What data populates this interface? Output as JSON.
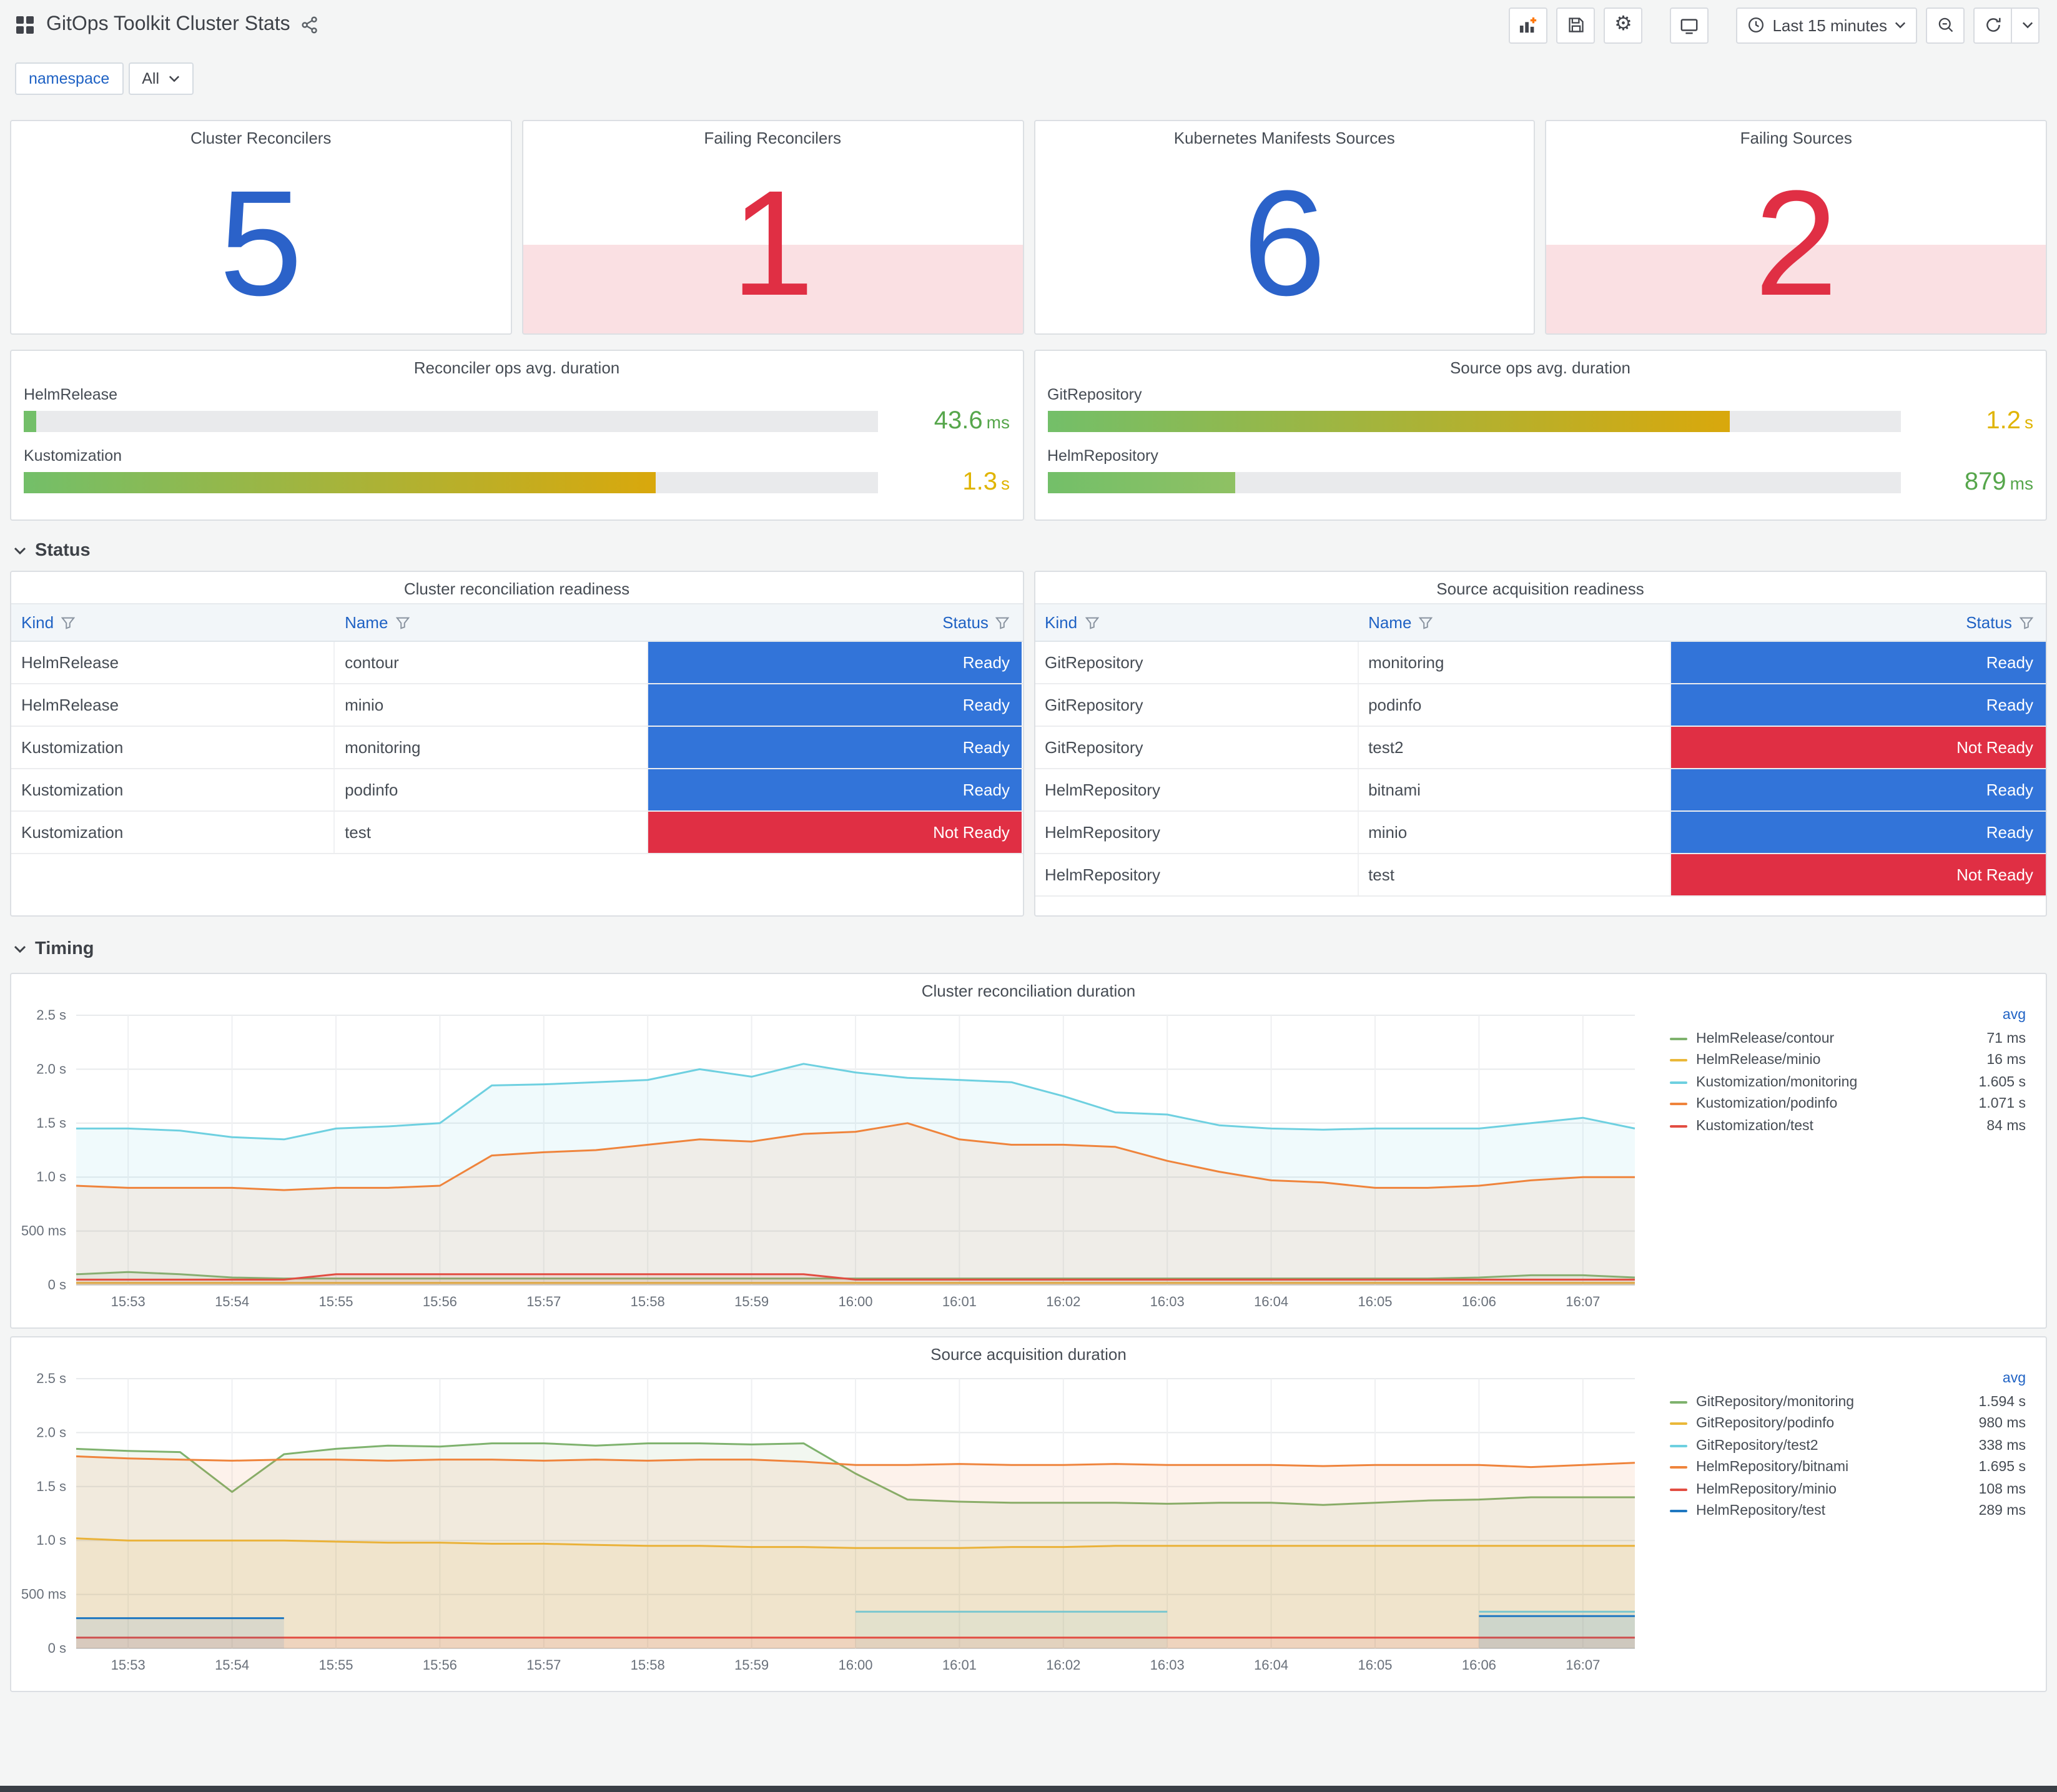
{
  "header": {
    "title": "GitOps Toolkit Cluster Stats",
    "time_range": "Last 15 minutes"
  },
  "variables": {
    "label": "namespace",
    "value": "All"
  },
  "sections": {
    "status": "Status",
    "timing": "Timing"
  },
  "colors": {
    "stat_ok": "#2b62c9",
    "stat_alert": "#e02f44",
    "alert_band": "rgba(224,47,68,0.15)"
  },
  "status_colors": {
    "Ready": "#3274d9",
    "Not Ready": "#e02f44"
  },
  "stats": [
    {
      "title": "Cluster Reconcilers",
      "value": "5",
      "state": "ok"
    },
    {
      "title": "Failing Reconcilers",
      "value": "1",
      "state": "alert"
    },
    {
      "title": "Kubernetes Manifests Sources",
      "value": "6",
      "state": "ok"
    },
    {
      "title": "Failing Sources",
      "value": "2",
      "state": "alert"
    }
  ],
  "gauges": [
    {
      "title": "Reconciler ops avg. duration",
      "rows": [
        {
          "label": "HelmRelease",
          "value": "43.6",
          "unit": "ms",
          "pct": 1.5,
          "value_color": "#56a64b",
          "fill_from": "#73bf69",
          "fill_to": "#73bf69"
        },
        {
          "label": "Kustomization",
          "value": "1.3",
          "unit": "s",
          "pct": 74,
          "value_color": "#e0b400",
          "fill_from": "#73bf69",
          "fill_to": "#d9a80c"
        }
      ]
    },
    {
      "title": "Source ops avg. duration",
      "rows": [
        {
          "label": "GitRepository",
          "value": "1.2",
          "unit": "s",
          "pct": 80,
          "value_color": "#e0b400",
          "fill_from": "#73bf69",
          "fill_to": "#d9a80c"
        },
        {
          "label": "HelmRepository",
          "value": "879",
          "unit": "ms",
          "pct": 22,
          "value_color": "#56a64b",
          "fill_from": "#73bf69",
          "fill_to": "#8fc163"
        }
      ]
    }
  ],
  "tables": [
    {
      "title": "Cluster reconciliation readiness",
      "columns": [
        "Kind",
        "Name",
        "Status"
      ],
      "rows": [
        {
          "kind": "HelmRelease",
          "name": "contour",
          "status": "Ready"
        },
        {
          "kind": "HelmRelease",
          "name": "minio",
          "status": "Ready"
        },
        {
          "kind": "Kustomization",
          "name": "monitoring",
          "status": "Ready"
        },
        {
          "kind": "Kustomization",
          "name": "podinfo",
          "status": "Ready"
        },
        {
          "kind": "Kustomization",
          "name": "test",
          "status": "Not Ready"
        }
      ]
    },
    {
      "title": "Source acquisition readiness",
      "columns": [
        "Kind",
        "Name",
        "Status"
      ],
      "rows": [
        {
          "kind": "GitRepository",
          "name": "monitoring",
          "status": "Ready"
        },
        {
          "kind": "GitRepository",
          "name": "podinfo",
          "status": "Ready"
        },
        {
          "kind": "GitRepository",
          "name": "test2",
          "status": "Not Ready"
        },
        {
          "kind": "HelmRepository",
          "name": "bitnami",
          "status": "Ready"
        },
        {
          "kind": "HelmRepository",
          "name": "minio",
          "status": "Ready"
        },
        {
          "kind": "HelmRepository",
          "name": "test",
          "status": "Not Ready"
        }
      ]
    }
  ],
  "chart_data": [
    {
      "type": "line",
      "title": "Cluster reconciliation duration",
      "legend_header": "avg",
      "legend_position": "right",
      "grid": true,
      "unit": "seconds",
      "ylim": [
        0,
        2.5
      ],
      "y_ticks": [
        "0 s",
        "500 ms",
        "1.0 s",
        "1.5 s",
        "2.0 s",
        "2.5 s"
      ],
      "x_ticks": [
        "15:53",
        "15:54",
        "15:55",
        "15:56",
        "15:57",
        "15:58",
        "15:59",
        "16:00",
        "16:01",
        "16:02",
        "16:03",
        "16:04",
        "16:05",
        "16:06",
        "16:07"
      ],
      "x_range_min": [
        0,
        15
      ],
      "x_tick_start_min": 0.5,
      "x_tick_step_min": 1,
      "point_interval_min": 0.5,
      "series": [
        {
          "name": "HelmRelease/contour",
          "color": "#7eb26d",
          "avg": "71 ms",
          "values": [
            0.1,
            0.12,
            0.1,
            0.07,
            0.06,
            0.06,
            0.06,
            0.06,
            0.06,
            0.06,
            0.06,
            0.06,
            0.06,
            0.06,
            0.06,
            0.06,
            0.06,
            0.06,
            0.06,
            0.06,
            0.06,
            0.06,
            0.06,
            0.06,
            0.06,
            0.06,
            0.06,
            0.07,
            0.09,
            0.09,
            0.07
          ]
        },
        {
          "name": "HelmRelease/minio",
          "color": "#eab839",
          "avg": "16 ms",
          "values": [
            0.02,
            0.02,
            0.02,
            0.02,
            0.02,
            0.02,
            0.02,
            0.02,
            0.02,
            0.02,
            0.02,
            0.02,
            0.02,
            0.02,
            0.02,
            0.02,
            0.02,
            0.02,
            0.02,
            0.02,
            0.02,
            0.02,
            0.02,
            0.02,
            0.02,
            0.02,
            0.02,
            0.02,
            0.02,
            0.02,
            0.02
          ]
        },
        {
          "name": "Kustomization/monitoring",
          "color": "#6ed0e0",
          "avg": "1.605 s",
          "values": [
            1.45,
            1.45,
            1.43,
            1.37,
            1.35,
            1.45,
            1.47,
            1.5,
            1.85,
            1.86,
            1.88,
            1.9,
            2.0,
            1.93,
            2.05,
            1.97,
            1.92,
            1.9,
            1.88,
            1.75,
            1.6,
            1.58,
            1.48,
            1.45,
            1.44,
            1.45,
            1.45,
            1.45,
            1.5,
            1.55,
            1.45
          ]
        },
        {
          "name": "Kustomization/podinfo",
          "color": "#ef843c",
          "avg": "1.071 s",
          "values": [
            0.92,
            0.9,
            0.9,
            0.9,
            0.88,
            0.9,
            0.9,
            0.92,
            1.2,
            1.23,
            1.25,
            1.3,
            1.35,
            1.33,
            1.4,
            1.42,
            1.5,
            1.35,
            1.3,
            1.3,
            1.28,
            1.15,
            1.05,
            0.97,
            0.95,
            0.9,
            0.9,
            0.92,
            0.97,
            1.0,
            1.0
          ]
        },
        {
          "name": "Kustomization/test",
          "color": "#e24d42",
          "avg": "84 ms",
          "values": [
            0.05,
            0.05,
            0.05,
            0.05,
            0.05,
            0.1,
            0.1,
            0.1,
            0.1,
            0.1,
            0.1,
            0.1,
            0.1,
            0.1,
            0.1,
            0.05,
            0.05,
            0.05,
            0.05,
            0.05,
            0.05,
            0.05,
            0.05,
            0.05,
            0.05,
            0.05,
            0.05,
            0.05,
            0.05,
            0.05,
            0.05
          ]
        }
      ]
    },
    {
      "type": "line",
      "title": "Source acquisition duration",
      "legend_header": "avg",
      "legend_position": "right",
      "grid": true,
      "unit": "seconds",
      "ylim": [
        0,
        2.5
      ],
      "y_ticks": [
        "0 s",
        "500 ms",
        "1.0 s",
        "1.5 s",
        "2.0 s",
        "2.5 s"
      ],
      "x_ticks": [
        "15:53",
        "15:54",
        "15:55",
        "15:56",
        "15:57",
        "15:58",
        "15:59",
        "16:00",
        "16:01",
        "16:02",
        "16:03",
        "16:04",
        "16:05",
        "16:06",
        "16:07"
      ],
      "x_range_min": [
        0,
        15
      ],
      "x_tick_start_min": 0.5,
      "x_tick_step_min": 1,
      "point_interval_min": 0.5,
      "series": [
        {
          "name": "GitRepository/monitoring",
          "color": "#7eb26d",
          "avg": "1.594 s",
          "values": [
            1.85,
            1.83,
            1.82,
            1.45,
            1.8,
            1.85,
            1.88,
            1.87,
            1.9,
            1.9,
            1.88,
            1.9,
            1.9,
            1.89,
            1.9,
            1.62,
            1.38,
            1.36,
            1.35,
            1.35,
            1.35,
            1.34,
            1.35,
            1.35,
            1.33,
            1.35,
            1.37,
            1.38,
            1.4,
            1.4,
            1.4
          ]
        },
        {
          "name": "GitRepository/podinfo",
          "color": "#eab839",
          "avg": "980 ms",
          "values": [
            1.02,
            1.0,
            1.0,
            1.0,
            1.0,
            0.99,
            0.98,
            0.98,
            0.97,
            0.97,
            0.96,
            0.95,
            0.95,
            0.94,
            0.94,
            0.93,
            0.93,
            0.93,
            0.94,
            0.94,
            0.95,
            0.95,
            0.95,
            0.95,
            0.95,
            0.95,
            0.95,
            0.95,
            0.95,
            0.95,
            0.95
          ]
        },
        {
          "name": "GitRepository/test2",
          "color": "#6ed0e0",
          "avg": "338 ms",
          "values": [
            null,
            null,
            null,
            null,
            null,
            null,
            null,
            null,
            null,
            null,
            null,
            null,
            null,
            null,
            null,
            0.34,
            0.34,
            0.34,
            0.34,
            0.34,
            0.34,
            0.34,
            null,
            null,
            null,
            null,
            null,
            0.34,
            0.34,
            0.34,
            0.34
          ]
        },
        {
          "name": "HelmRepository/bitnami",
          "color": "#ef843c",
          "avg": "1.695 s",
          "values": [
            1.78,
            1.76,
            1.75,
            1.74,
            1.75,
            1.75,
            1.74,
            1.75,
            1.75,
            1.74,
            1.75,
            1.74,
            1.75,
            1.75,
            1.73,
            1.7,
            1.7,
            1.71,
            1.7,
            1.7,
            1.71,
            1.7,
            1.7,
            1.7,
            1.69,
            1.7,
            1.7,
            1.7,
            1.68,
            1.7,
            1.72
          ]
        },
        {
          "name": "HelmRepository/minio",
          "color": "#e24d42",
          "avg": "108 ms",
          "values": [
            0.1,
            0.1,
            0.1,
            0.1,
            0.1,
            0.1,
            0.1,
            0.1,
            0.1,
            0.1,
            0.1,
            0.1,
            0.1,
            0.1,
            0.1,
            0.1,
            0.1,
            0.1,
            0.1,
            0.1,
            0.1,
            0.1,
            0.1,
            0.1,
            0.1,
            0.1,
            0.1,
            0.1,
            0.1,
            0.1,
            0.1
          ]
        },
        {
          "name": "HelmRepository/test",
          "color": "#1f78c1",
          "avg": "289 ms",
          "values": [
            0.28,
            0.28,
            0.28,
            0.28,
            0.28,
            null,
            null,
            null,
            null,
            null,
            null,
            null,
            null,
            null,
            null,
            null,
            null,
            null,
            null,
            null,
            null,
            null,
            null,
            null,
            null,
            null,
            null,
            0.3,
            0.3,
            0.3,
            0.3
          ]
        }
      ]
    }
  ]
}
